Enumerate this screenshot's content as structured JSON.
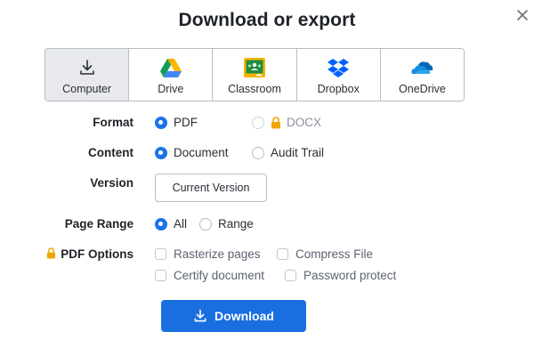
{
  "dialog": {
    "title": "Download or export"
  },
  "destinations": [
    {
      "label": "Computer",
      "icon": "download-icon",
      "selected": true
    },
    {
      "label": "Drive",
      "icon": "google-drive-icon",
      "selected": false
    },
    {
      "label": "Classroom",
      "icon": "google-classroom-icon",
      "selected": false
    },
    {
      "label": "Dropbox",
      "icon": "dropbox-icon",
      "selected": false
    },
    {
      "label": "OneDrive",
      "icon": "onedrive-icon",
      "selected": false
    }
  ],
  "format": {
    "label": "Format",
    "options": [
      {
        "label": "PDF",
        "selected": true
      },
      {
        "label": "DOCX",
        "selected": false,
        "locked": true
      }
    ]
  },
  "content": {
    "label": "Content",
    "options": [
      {
        "label": "Document",
        "selected": true
      },
      {
        "label": "Audit Trail",
        "selected": false
      }
    ]
  },
  "version": {
    "label": "Version",
    "value": "Current Version"
  },
  "page_range": {
    "label": "Page Range",
    "options": [
      {
        "label": "All",
        "selected": true
      },
      {
        "label": "Range",
        "selected": false
      }
    ]
  },
  "pdf_options": {
    "label": "PDF Options",
    "locked": true,
    "options": [
      {
        "label": "Rasterize pages",
        "checked": false
      },
      {
        "label": "Compress File",
        "checked": false
      },
      {
        "label": "Certify document",
        "checked": false
      },
      {
        "label": "Password protect",
        "checked": false
      }
    ]
  },
  "download_button": {
    "label": "Download"
  },
  "colors": {
    "primary": "#1a6fe0",
    "selected_tile": "#e8e9ec",
    "lock": "#f0a500"
  }
}
